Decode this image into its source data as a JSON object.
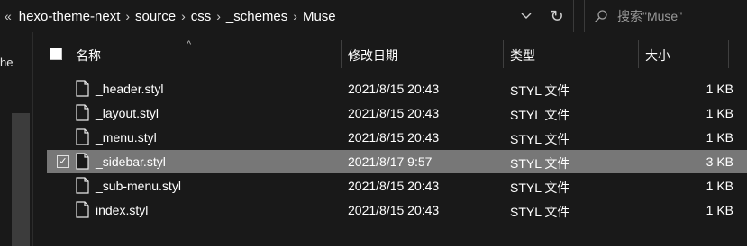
{
  "address_bar": {
    "overflow": "«",
    "breadcrumbs": [
      "hexo-theme-next",
      "source",
      "css",
      "_schemes",
      "Muse"
    ]
  },
  "search": {
    "placeholder": "搜索\"Muse\""
  },
  "left_pane": {
    "fragment": "he"
  },
  "columns": {
    "name": "名称",
    "date": "修改日期",
    "type": "类型",
    "size": "大小"
  },
  "files": [
    {
      "name": "_header.styl",
      "date": "2021/8/15 20:43",
      "type": "STYL 文件",
      "size": "1 KB",
      "selected": false
    },
    {
      "name": "_layout.styl",
      "date": "2021/8/15 20:43",
      "type": "STYL 文件",
      "size": "1 KB",
      "selected": false
    },
    {
      "name": "_menu.styl",
      "date": "2021/8/15 20:43",
      "type": "STYL 文件",
      "size": "1 KB",
      "selected": false
    },
    {
      "name": "_sidebar.styl",
      "date": "2021/8/17 9:57",
      "type": "STYL 文件",
      "size": "3 KB",
      "selected": true
    },
    {
      "name": "_sub-menu.styl",
      "date": "2021/8/15 20:43",
      "type": "STYL 文件",
      "size": "1 KB",
      "selected": false
    },
    {
      "name": "index.styl",
      "date": "2021/8/15 20:43",
      "type": "STYL 文件",
      "size": "1 KB",
      "selected": false
    }
  ],
  "colors": {
    "background": "#191919",
    "selected_row": "#777777",
    "text": "#ffffff",
    "muted": "#9a9a9a"
  }
}
